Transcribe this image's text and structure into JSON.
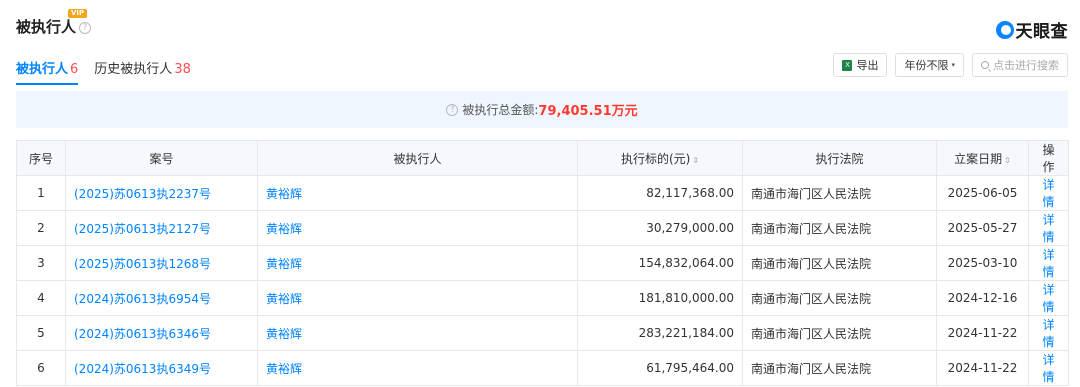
{
  "header": {
    "title": "被执行人",
    "vip_badge": "VIP",
    "help": "?",
    "brand": "天眼查"
  },
  "tabs": [
    {
      "label": "被执行人",
      "count": "6"
    },
    {
      "label": "历史被执行人",
      "count": "38"
    }
  ],
  "toolbar": {
    "export_icon_glyph": "X",
    "export_label": "导出",
    "year_filter": "年份不限",
    "caret": "▾",
    "search_placeholder": "点击进行搜索"
  },
  "summary": {
    "label": "被执行总金额:",
    "amount": "79,405.51万元"
  },
  "table": {
    "sort_glyph": "⇕",
    "headers": {
      "index": "序号",
      "case": "案号",
      "name": "被执行人",
      "amount": "执行标的(元)",
      "court": "执行法院",
      "date": "立案日期",
      "op": "操作"
    },
    "rows": [
      {
        "index": "1",
        "case": "(2025)苏0613执2237号",
        "name": "黄裕辉",
        "amount": "82,117,368.00",
        "court": "南通市海门区人民法院",
        "date": "2025-06-05",
        "op": "详情"
      },
      {
        "index": "2",
        "case": "(2025)苏0613执2127号",
        "name": "黄裕辉",
        "amount": "30,279,000.00",
        "court": "南通市海门区人民法院",
        "date": "2025-05-27",
        "op": "详情"
      },
      {
        "index": "3",
        "case": "(2025)苏0613执1268号",
        "name": "黄裕辉",
        "amount": "154,832,064.00",
        "court": "南通市海门区人民法院",
        "date": "2025-03-10",
        "op": "详情"
      },
      {
        "index": "4",
        "case": "(2024)苏0613执6954号",
        "name": "黄裕辉",
        "amount": "181,810,000.00",
        "court": "南通市海门区人民法院",
        "date": "2024-12-16",
        "op": "详情"
      },
      {
        "index": "5",
        "case": "(2024)苏0613执6346号",
        "name": "黄裕辉",
        "amount": "283,221,184.00",
        "court": "南通市海门区人民法院",
        "date": "2024-11-22",
        "op": "详情"
      },
      {
        "index": "6",
        "case": "(2024)苏0613执6349号",
        "name": "黄裕辉",
        "amount": "61,795,464.00",
        "court": "南通市海门区人民法院",
        "date": "2024-11-22",
        "op": "详情"
      }
    ]
  }
}
